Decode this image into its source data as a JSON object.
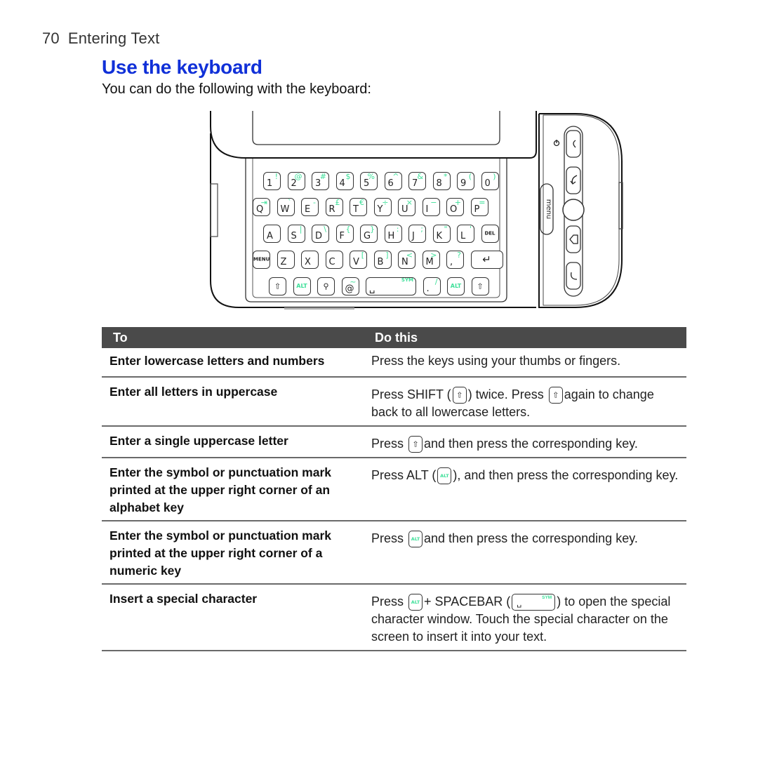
{
  "running_head": {
    "page_number": "70",
    "chapter": "Entering Text"
  },
  "section": {
    "title": "Use the keyboard",
    "intro": "You can do the following with the keyboard:"
  },
  "colors": {
    "title_blue": "#1030d8",
    "alt_green": "#3fe09a",
    "table_header_bg": "#4a4a4a"
  },
  "device": {
    "side_buttons": [
      "power-icon",
      "call-end-icon",
      "back-icon",
      "trackball",
      "home-icon",
      "call-icon"
    ],
    "menu_label": "menu",
    "keyboard": {
      "row1": [
        {
          "main": "1",
          "alt": "!"
        },
        {
          "main": "2",
          "alt": "@"
        },
        {
          "main": "3",
          "alt": "#"
        },
        {
          "main": "4",
          "alt": "$"
        },
        {
          "main": "5",
          "alt": "%"
        },
        {
          "main": "6",
          "alt": "^"
        },
        {
          "main": "7",
          "alt": "&"
        },
        {
          "main": "8",
          "alt": "*"
        },
        {
          "main": "9",
          "alt": "("
        },
        {
          "main": "0",
          "alt": ")"
        }
      ],
      "row2": [
        {
          "main": "Q",
          "alt": "⇥"
        },
        {
          "main": "W",
          "alt": "`"
        },
        {
          "main": "E",
          "alt": "-"
        },
        {
          "main": "R",
          "alt": "£"
        },
        {
          "main": "T",
          "alt": "€"
        },
        {
          "main": "Y",
          "alt": "÷"
        },
        {
          "main": "U",
          "alt": "×"
        },
        {
          "main": "I",
          "alt": "−"
        },
        {
          "main": "O",
          "alt": "+"
        },
        {
          "main": "P",
          "alt": "="
        }
      ],
      "row3": [
        {
          "main": "A",
          "alt": ""
        },
        {
          "main": "S",
          "alt": "|"
        },
        {
          "main": "D",
          "alt": "\\"
        },
        {
          "main": "F",
          "alt": "{"
        },
        {
          "main": "G",
          "alt": "}"
        },
        {
          "main": "H",
          "alt": ":"
        },
        {
          "main": "J",
          "alt": ";"
        },
        {
          "main": "K",
          "alt": "\""
        },
        {
          "main": "L",
          "alt": "'"
        }
      ],
      "del_label": "DEL",
      "menu_key_label": "MENU",
      "row4": [
        {
          "main": "Z",
          "alt": ""
        },
        {
          "main": "X",
          "alt": ""
        },
        {
          "main": "C",
          "alt": ""
        },
        {
          "main": "V",
          "alt": "["
        },
        {
          "main": "B",
          "alt": "]"
        },
        {
          "main": "N",
          "alt": "<"
        },
        {
          "main": "M",
          "alt": ">"
        },
        {
          "main": ",",
          "alt": "?"
        }
      ],
      "enter_glyph": "↵",
      "row5": {
        "shift_glyph": "⇧",
        "alt_label": "ALT",
        "search_glyph": "⚲",
        "at_main": "@",
        "at_alt": "~",
        "space_glyph": "␣",
        "sym_label": "SYM",
        "period_main": ".",
        "period_alt": "/"
      }
    }
  },
  "table": {
    "headers": [
      "To",
      "Do this"
    ],
    "rows": [
      {
        "to": "Enter lowercase letters and numbers",
        "do": "Press the keys using your thumbs or fingers."
      },
      {
        "to": "Enter all letters in uppercase",
        "do_parts": [
          "Press SHIFT (",
          ") twice. Press ",
          "again to change back to all lowercase letters."
        ]
      },
      {
        "to": "Enter a single uppercase letter",
        "do_parts": [
          "Press ",
          "and then press the corresponding key."
        ]
      },
      {
        "to": "Enter the symbol or punctuation mark printed at the upper right corner of an alphabet key",
        "do_parts": [
          "Press ALT (",
          "), and then press the corresponding key."
        ]
      },
      {
        "to": "Enter the symbol or punctuation mark printed at the upper right corner of a numeric key",
        "do_parts": [
          "Press ",
          "and then press the corresponding key."
        ]
      },
      {
        "to": "Insert a special character",
        "do_parts": [
          "Press ",
          "+ SPACEBAR (",
          ") to open the special character window. Touch the special character on the screen to insert it into your text."
        ]
      }
    ],
    "inline_keys": {
      "shift": "⇧",
      "alt": "ALT",
      "space": "␣",
      "sym": "SYM"
    }
  }
}
